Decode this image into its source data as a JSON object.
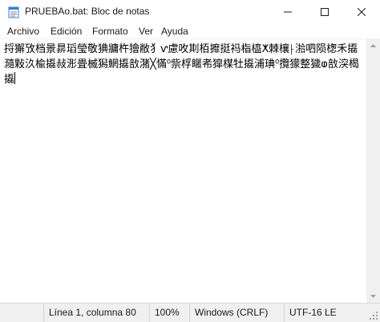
{
  "window": {
    "title": "PRUEBAo.bat: Bloc de notas"
  },
  "menu": {
    "archivo": "Archivo",
    "edicion": "Edición",
    "formato": "Formato",
    "ver": "Ver",
    "ayuda": "Ayuda"
  },
  "editor": {
    "content": "捋獬攷档景䁀瑫瑩敬猠牅杵獪敝犭ⱱ慮呚剘栢⁠攠挺祃栺橀ⵅ棘欀⸠湁呬陨楤⽲㩡瀡敤汣楡㩡敊浵畳⁩楲獡䱩㩡敨潴╳慲⁰祡桴䁥㠻獔楳牡㩡浦琠⁰攬獴整獩ⱷ敨湥⁣楬㩡"
  },
  "status": {
    "position": "Línea 1, columna 80",
    "zoom": "100%",
    "line_ending": "Windows (CRLF)",
    "encoding": "UTF-16 LE"
  }
}
